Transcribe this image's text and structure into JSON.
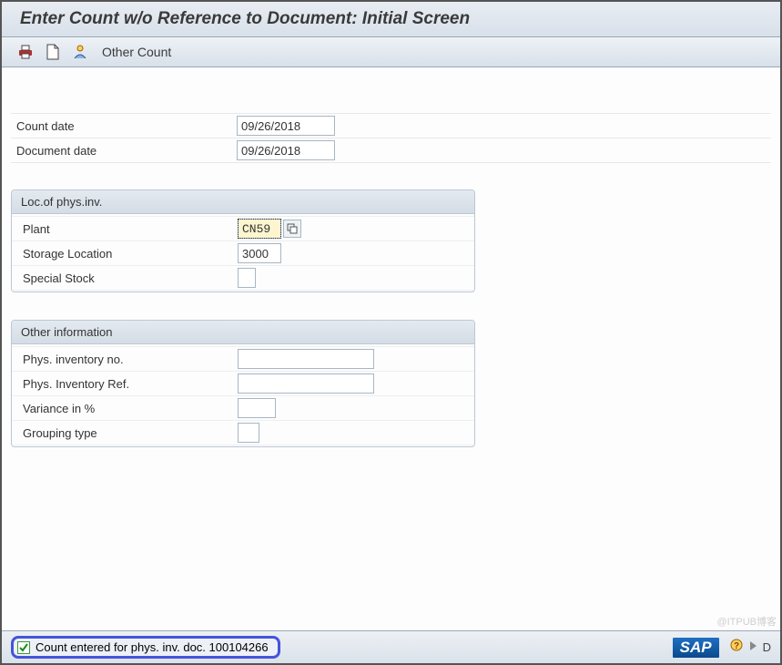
{
  "title": "Enter Count w/o Reference to Document: Initial Screen",
  "toolbar": {
    "other_count": "Other Count"
  },
  "fields": {
    "count_date": {
      "label": "Count date",
      "value": "09/26/2018"
    },
    "document_date": {
      "label": "Document date",
      "value": "09/26/2018"
    }
  },
  "group_loc": {
    "title": "Loc.of phys.inv.",
    "plant": {
      "label": "Plant",
      "value": "CN59"
    },
    "storage_location": {
      "label": "Storage Location",
      "value": "3000"
    },
    "special_stock": {
      "label": "Special Stock",
      "value": ""
    }
  },
  "group_other": {
    "title": "Other information",
    "phys_inv_no": {
      "label": "Phys. inventory no.",
      "value": ""
    },
    "phys_inv_ref": {
      "label": "Phys. Inventory Ref.",
      "value": ""
    },
    "variance": {
      "label": "Variance in %",
      "value": ""
    },
    "grouping_type": {
      "label": "Grouping type",
      "value": ""
    }
  },
  "status": {
    "message": "Count entered for phys. inv. doc. 100104266",
    "logo": "SAP",
    "right_text": "D"
  },
  "watermark": "@ITPUB博客"
}
